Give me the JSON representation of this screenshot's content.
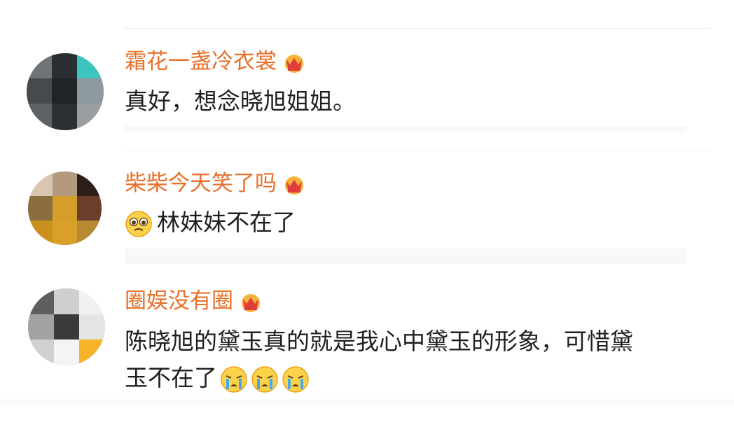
{
  "comments": [
    {
      "username": "霜花一盏冷衣裳",
      "vip_icon": "crown-vip-icon",
      "text": "真好，想念晓旭姐姐。"
    },
    {
      "username": "柴柴今天笑了吗",
      "vip_icon": "crown-vip-icon",
      "emoji_prefix": "pleading-face-emoji",
      "text": "林妹妹不在了"
    },
    {
      "username": "圈娱没有圈",
      "vip_icon": "crown-vip-icon",
      "text_line1": "陈晓旭的黛玉真的就是我心中黛玉的形象，可惜黛",
      "text_line2": "玉不在了",
      "emoji_suffix": [
        "crying-face-emoji",
        "crying-face-emoji",
        "crying-face-emoji"
      ]
    }
  ],
  "colors": {
    "username": "#e8702a",
    "text": "#1f1f1f",
    "divider": "#ececec"
  }
}
